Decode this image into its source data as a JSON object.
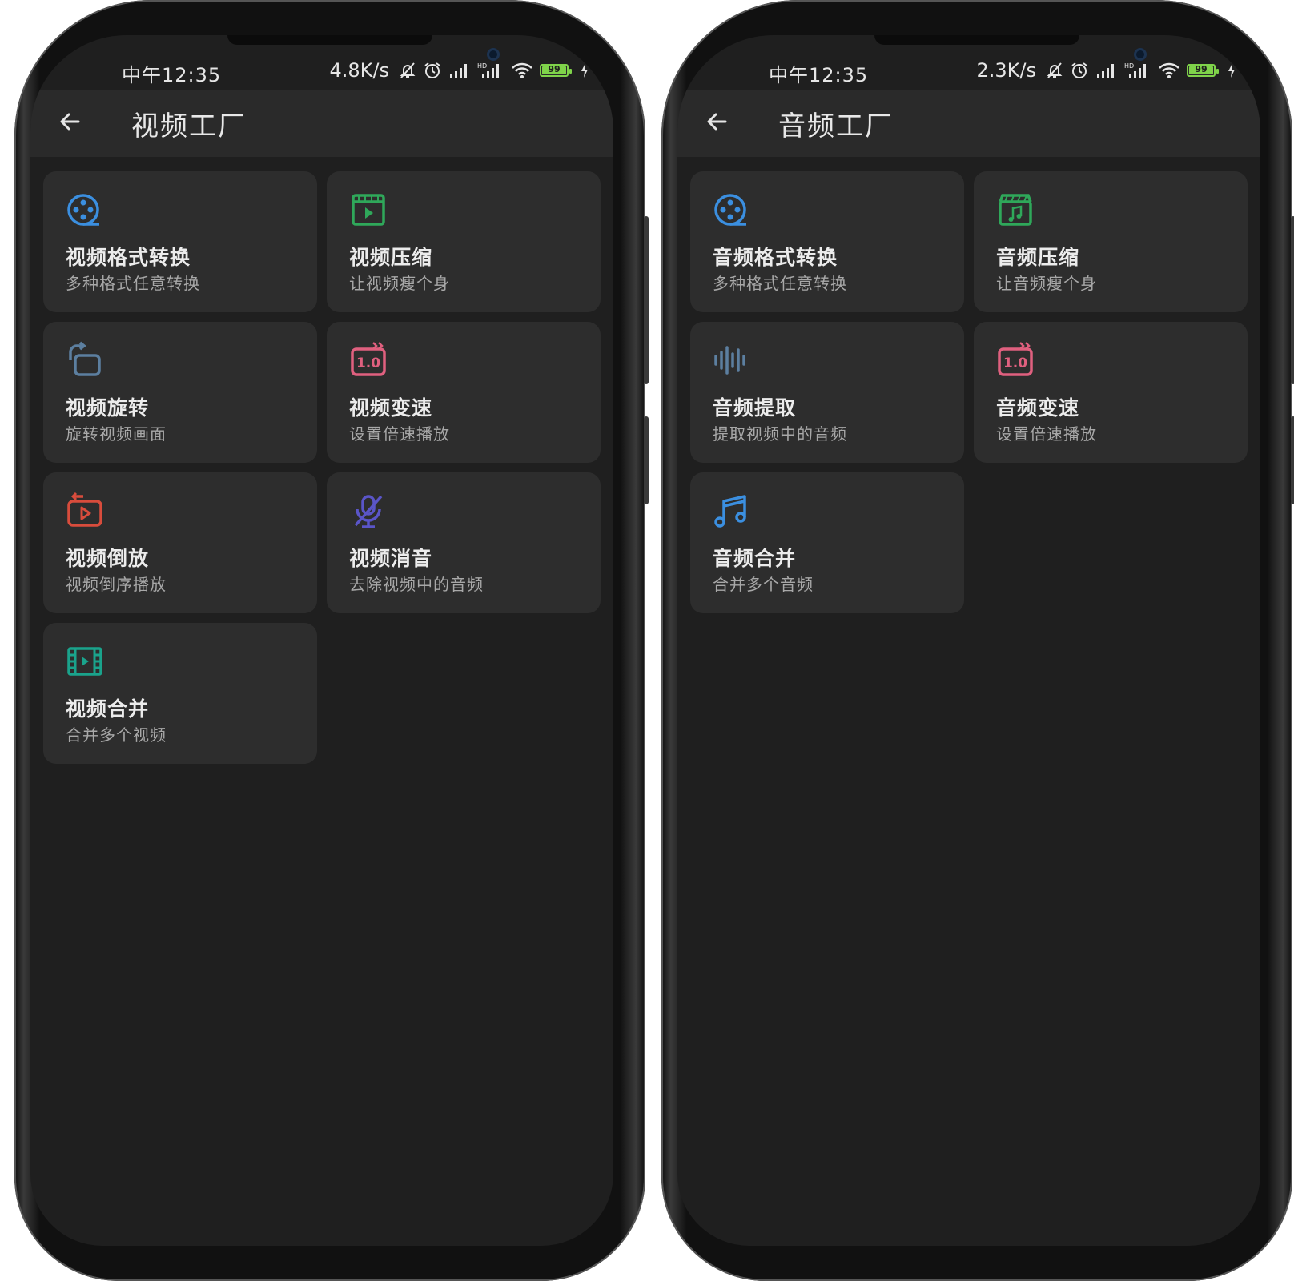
{
  "screens": [
    {
      "status": {
        "time": "中午12:35",
        "speed": "4.8K/s",
        "battery": "99"
      },
      "title": "视频工厂",
      "cards": [
        {
          "title": "视频格式转换",
          "subtitle": "多种格式任意转换",
          "icon": "film-reel-icon",
          "color": "#3b8fe0"
        },
        {
          "title": "视频压缩",
          "subtitle": "让视频瘦个身",
          "icon": "video-play-frame-icon",
          "color": "#2fa85a"
        },
        {
          "title": "视频旋转",
          "subtitle": "旋转视频画面",
          "icon": "rotate-icon",
          "color": "#5c7fa0"
        },
        {
          "title": "视频变速",
          "subtitle": "设置倍速播放",
          "icon": "speed-icon",
          "color": "#e0607f"
        },
        {
          "title": "视频倒放",
          "subtitle": "视频倒序播放",
          "icon": "reverse-play-icon",
          "color": "#d84c3c"
        },
        {
          "title": "视频消音",
          "subtitle": "去除视频中的音频",
          "icon": "mic-off-icon",
          "color": "#5a55c8"
        },
        {
          "title": "视频合并",
          "subtitle": "合并多个视频",
          "icon": "film-strip-icon",
          "color": "#1aa38c"
        }
      ]
    },
    {
      "status": {
        "time": "中午12:35",
        "speed": "2.3K/s",
        "battery": "99"
      },
      "title": "音频工厂",
      "cards": [
        {
          "title": "音频格式转换",
          "subtitle": "多种格式任意转换",
          "icon": "film-reel-icon",
          "color": "#3b8fe0"
        },
        {
          "title": "音频压缩",
          "subtitle": "让音频瘦个身",
          "icon": "music-clapboard-icon",
          "color": "#2fa85a"
        },
        {
          "title": "音频提取",
          "subtitle": "提取视频中的音频",
          "icon": "sound-wave-icon",
          "color": "#5c7fa0"
        },
        {
          "title": "音频变速",
          "subtitle": "设置倍速播放",
          "icon": "speed-icon",
          "color": "#e0607f"
        },
        {
          "title": "音频合并",
          "subtitle": "合并多个音频",
          "icon": "music-note-icon",
          "color": "#3b8fe0"
        }
      ]
    }
  ]
}
